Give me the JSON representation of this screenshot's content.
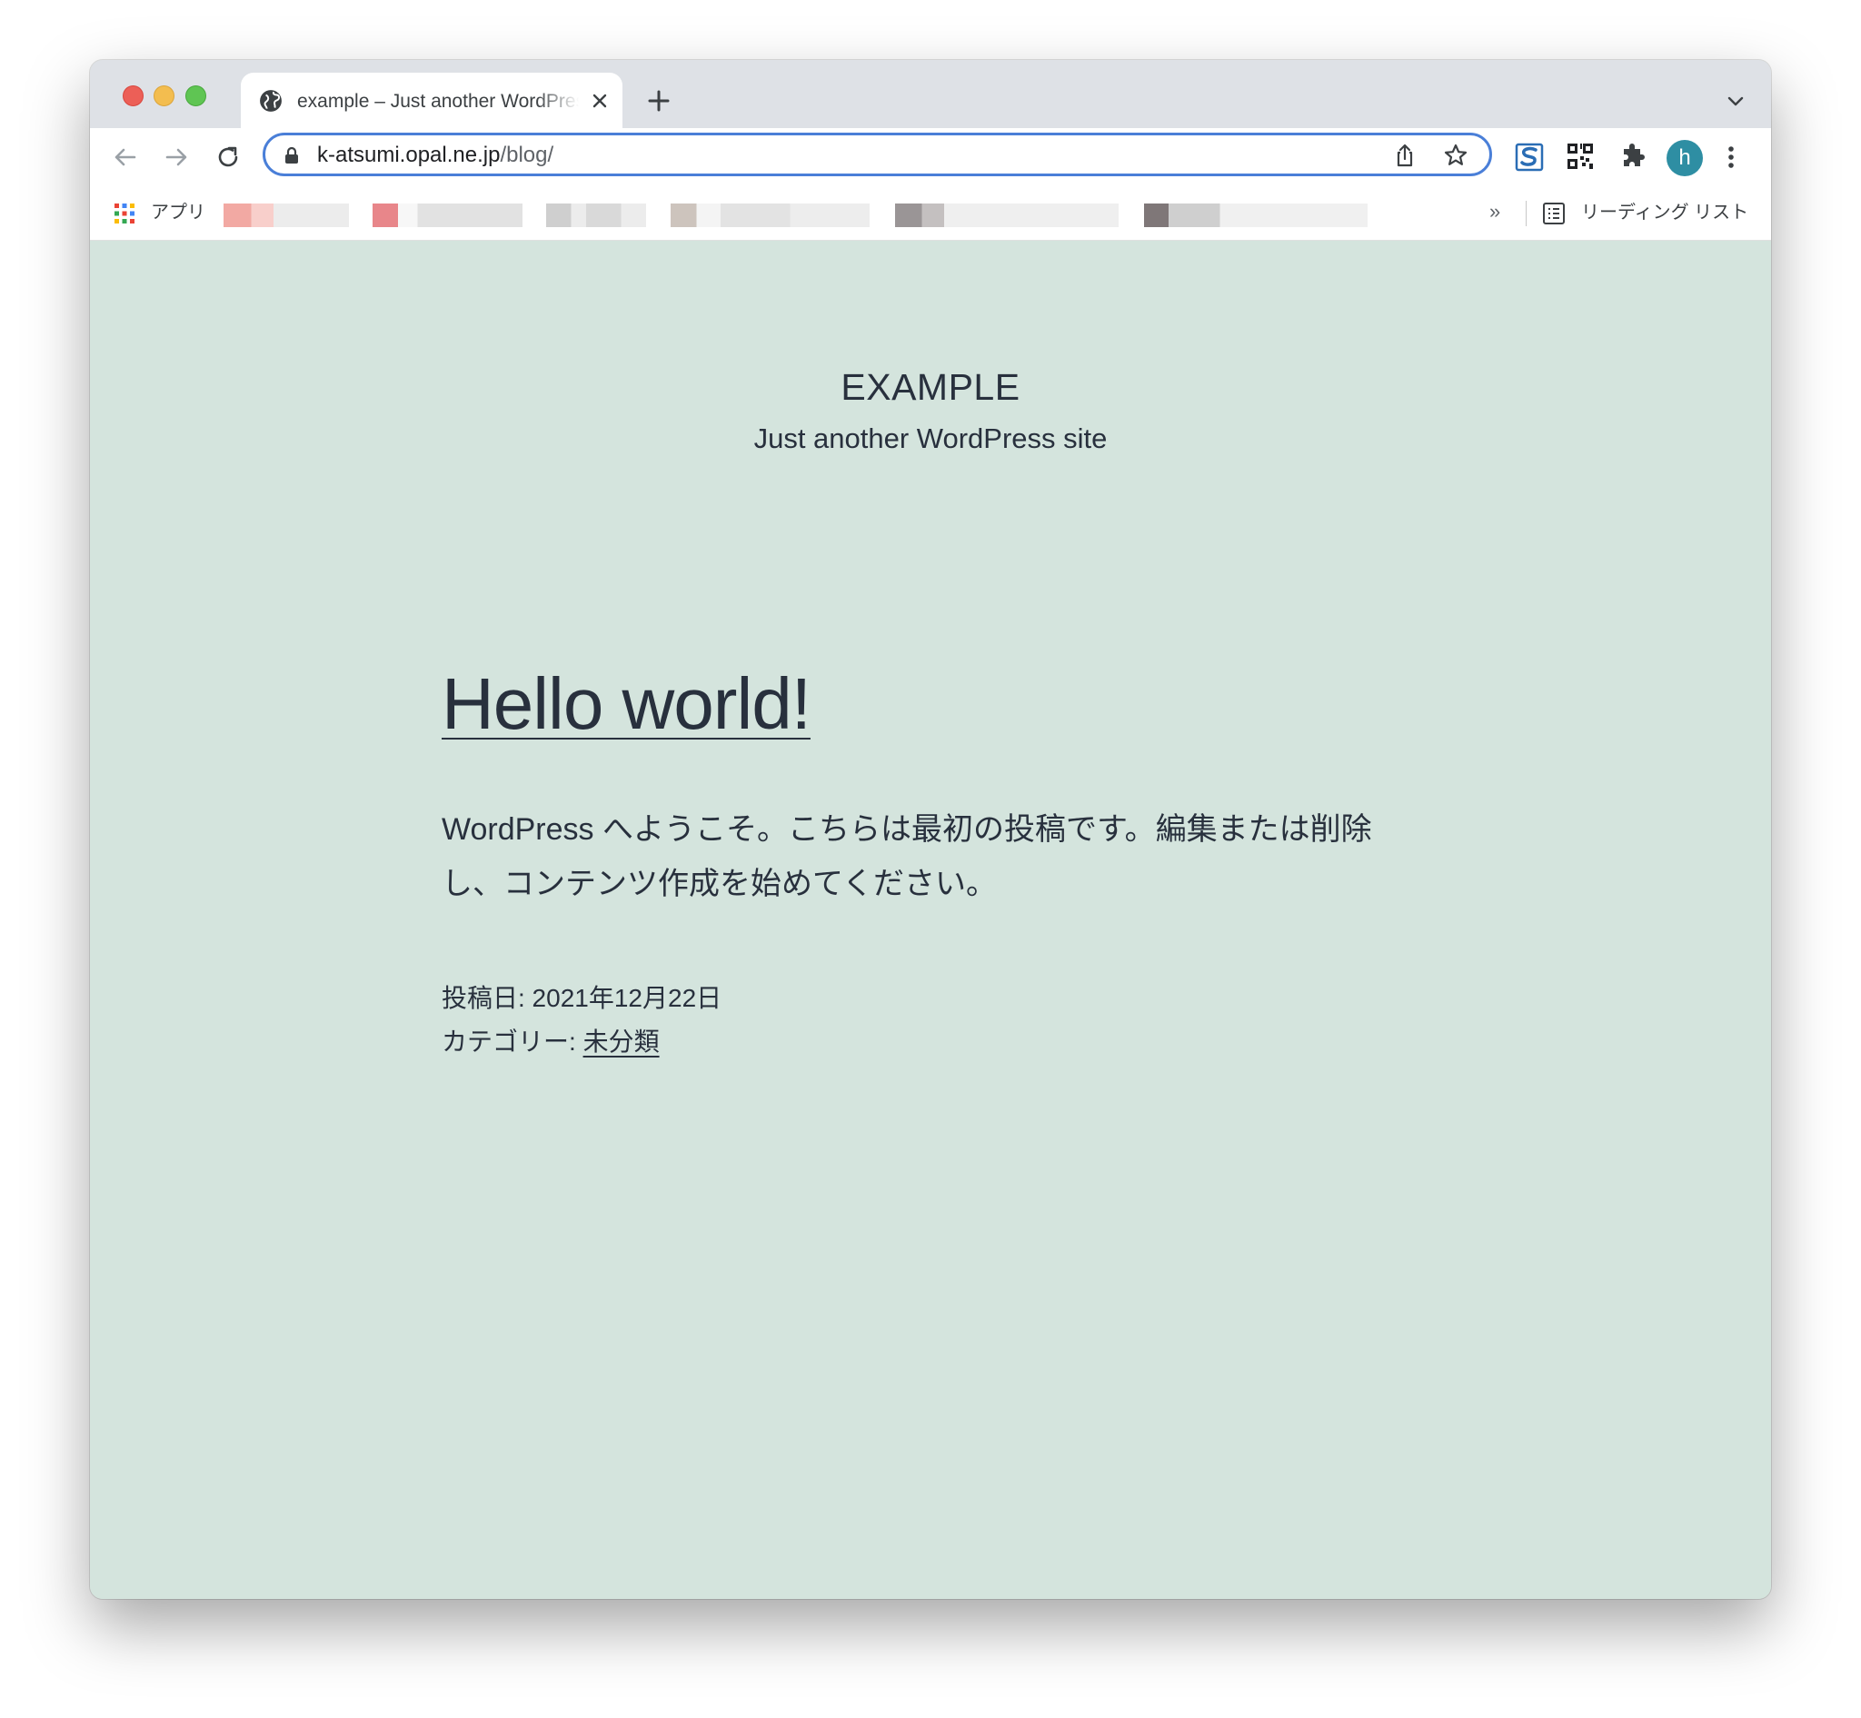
{
  "browser": {
    "tab": {
      "title": "example – Just another WordPress site",
      "favicon": "globe-icon"
    },
    "toolbar": {
      "url_host": "k-atsumi.opal.ne.jp",
      "url_path": "/blog/",
      "profile_initial": "h",
      "profile_color": "#2e8ea3"
    },
    "bookmarks": {
      "apps_label": "アプリ",
      "more_label": "»",
      "reading_list_label": "リーディング リスト"
    }
  },
  "site": {
    "title": "EXAMPLE",
    "description": "Just another WordPress site"
  },
  "post": {
    "title": "Hello world!",
    "body": "WordPress へようこそ。こちらは最初の投稿です。編集または削除し、コンテンツ作成を始めてください。",
    "date_label": "投稿日: 2021年12月22日",
    "category_prefix": "カテゴリー: ",
    "category": "未分類"
  },
  "colors": {
    "page_background": "#d4e4dd",
    "text": "#28303d",
    "omnibox_focus": "#4a7fd8"
  }
}
